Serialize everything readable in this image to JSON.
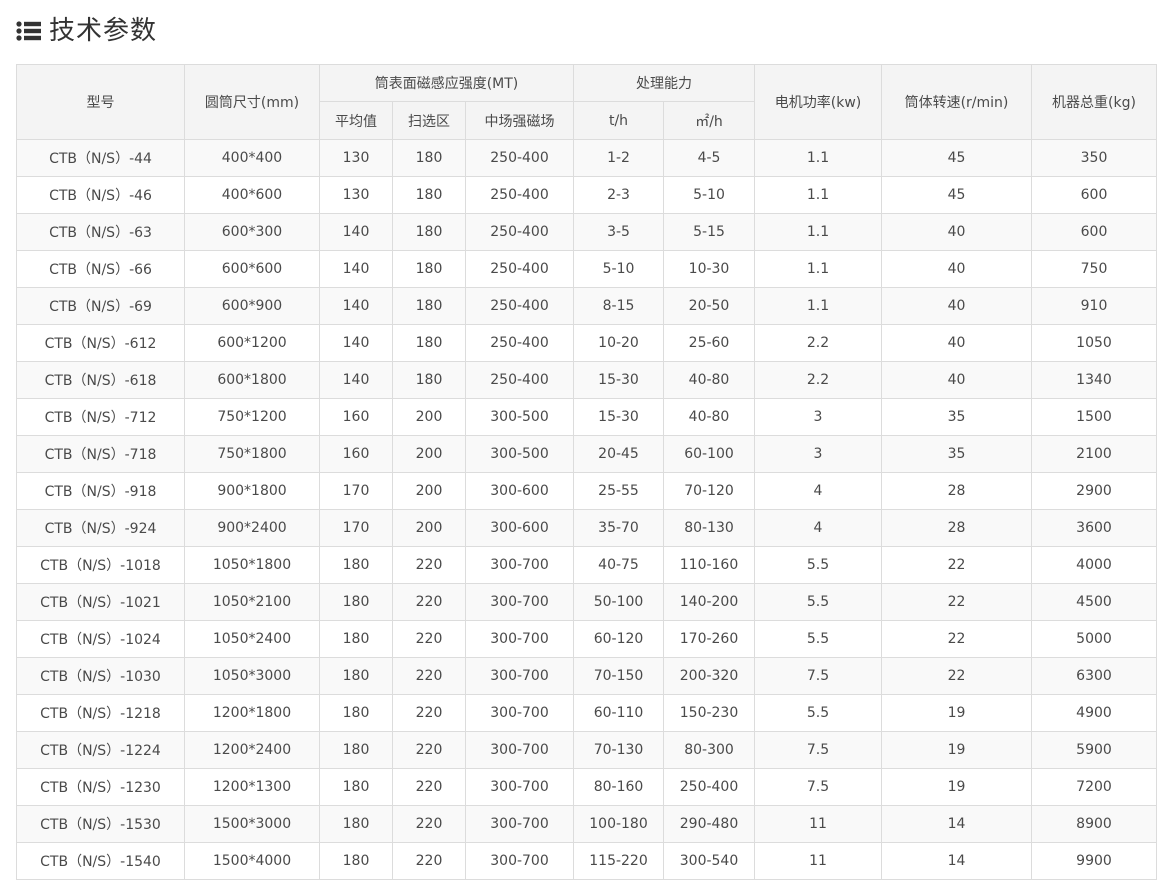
{
  "header": {
    "title": "技术参数",
    "icon": "list-icon"
  },
  "table": {
    "headers": {
      "model": "型号",
      "drum_size": "圆筒尺寸(mm)",
      "magnetic_group": "筒表面磁感应强度(MT)",
      "capacity_group": "处理能力",
      "motor_power": "电机功率(kw)",
      "drum_speed": "筒体转速(r/min)",
      "total_weight": "机器总重(kg)",
      "avg_value": "平均值",
      "sweep_zone": "扫选区",
      "mid_field": "中场强磁场",
      "cap_th": "t/h",
      "cap_m2h": "㎡/h"
    },
    "rows": [
      [
        "CTB（N/S）-44",
        "400*400",
        "130",
        "180",
        "250-400",
        "1-2",
        "4-5",
        "1.1",
        "45",
        "350"
      ],
      [
        "CTB（N/S）-46",
        "400*600",
        "130",
        "180",
        "250-400",
        "2-3",
        "5-10",
        "1.1",
        "45",
        "600"
      ],
      [
        "CTB（N/S）-63",
        "600*300",
        "140",
        "180",
        "250-400",
        "3-5",
        "5-15",
        "1.1",
        "40",
        "600"
      ],
      [
        "CTB（N/S）-66",
        "600*600",
        "140",
        "180",
        "250-400",
        "5-10",
        "10-30",
        "1.1",
        "40",
        "750"
      ],
      [
        "CTB（N/S）-69",
        "600*900",
        "140",
        "180",
        "250-400",
        "8-15",
        "20-50",
        "1.1",
        "40",
        "910"
      ],
      [
        "CTB（N/S）-612",
        "600*1200",
        "140",
        "180",
        "250-400",
        "10-20",
        "25-60",
        "2.2",
        "40",
        "1050"
      ],
      [
        "CTB（N/S）-618",
        "600*1800",
        "140",
        "180",
        "250-400",
        "15-30",
        "40-80",
        "2.2",
        "40",
        "1340"
      ],
      [
        "CTB（N/S）-712",
        "750*1200",
        "160",
        "200",
        "300-500",
        "15-30",
        "40-80",
        "3",
        "35",
        "1500"
      ],
      [
        "CTB（N/S）-718",
        "750*1800",
        "160",
        "200",
        "300-500",
        "20-45",
        "60-100",
        "3",
        "35",
        "2100"
      ],
      [
        "CTB（N/S）-918",
        "900*1800",
        "170",
        "200",
        "300-600",
        "25-55",
        "70-120",
        "4",
        "28",
        "2900"
      ],
      [
        "CTB（N/S）-924",
        "900*2400",
        "170",
        "200",
        "300-600",
        "35-70",
        "80-130",
        "4",
        "28",
        "3600"
      ],
      [
        "CTB（N/S）-1018",
        "1050*1800",
        "180",
        "220",
        "300-700",
        "40-75",
        "110-160",
        "5.5",
        "22",
        "4000"
      ],
      [
        "CTB（N/S）-1021",
        "1050*2100",
        "180",
        "220",
        "300-700",
        "50-100",
        "140-200",
        "5.5",
        "22",
        "4500"
      ],
      [
        "CTB（N/S）-1024",
        "1050*2400",
        "180",
        "220",
        "300-700",
        "60-120",
        "170-260",
        "5.5",
        "22",
        "5000"
      ],
      [
        "CTB（N/S）-1030",
        "1050*3000",
        "180",
        "220",
        "300-700",
        "70-150",
        "200-320",
        "7.5",
        "22",
        "6300"
      ],
      [
        "CTB（N/S）-1218",
        "1200*1800",
        "180",
        "220",
        "300-700",
        "60-110",
        "150-230",
        "5.5",
        "19",
        "4900"
      ],
      [
        "CTB（N/S）-1224",
        "1200*2400",
        "180",
        "220",
        "300-700",
        "70-130",
        "80-300",
        "7.5",
        "19",
        "5900"
      ],
      [
        "CTB（N/S）-1230",
        "1200*1300",
        "180",
        "220",
        "300-700",
        "80-160",
        "250-400",
        "7.5",
        "19",
        "7200"
      ],
      [
        "CTB（N/S）-1530",
        "1500*3000",
        "180",
        "220",
        "300-700",
        "100-180",
        "290-480",
        "11",
        "14",
        "8900"
      ],
      [
        "CTB（N/S）-1540",
        "1500*4000",
        "180",
        "220",
        "300-700",
        "115-220",
        "300-540",
        "11",
        "14",
        "9900"
      ]
    ]
  },
  "colors": {
    "header_bg": "#f4f4f4",
    "row_odd_bg": "#f9f9f9",
    "row_even_bg": "#ffffff",
    "border": "#dcdcdc",
    "text": "#4a4a4a",
    "title": "#333333"
  }
}
